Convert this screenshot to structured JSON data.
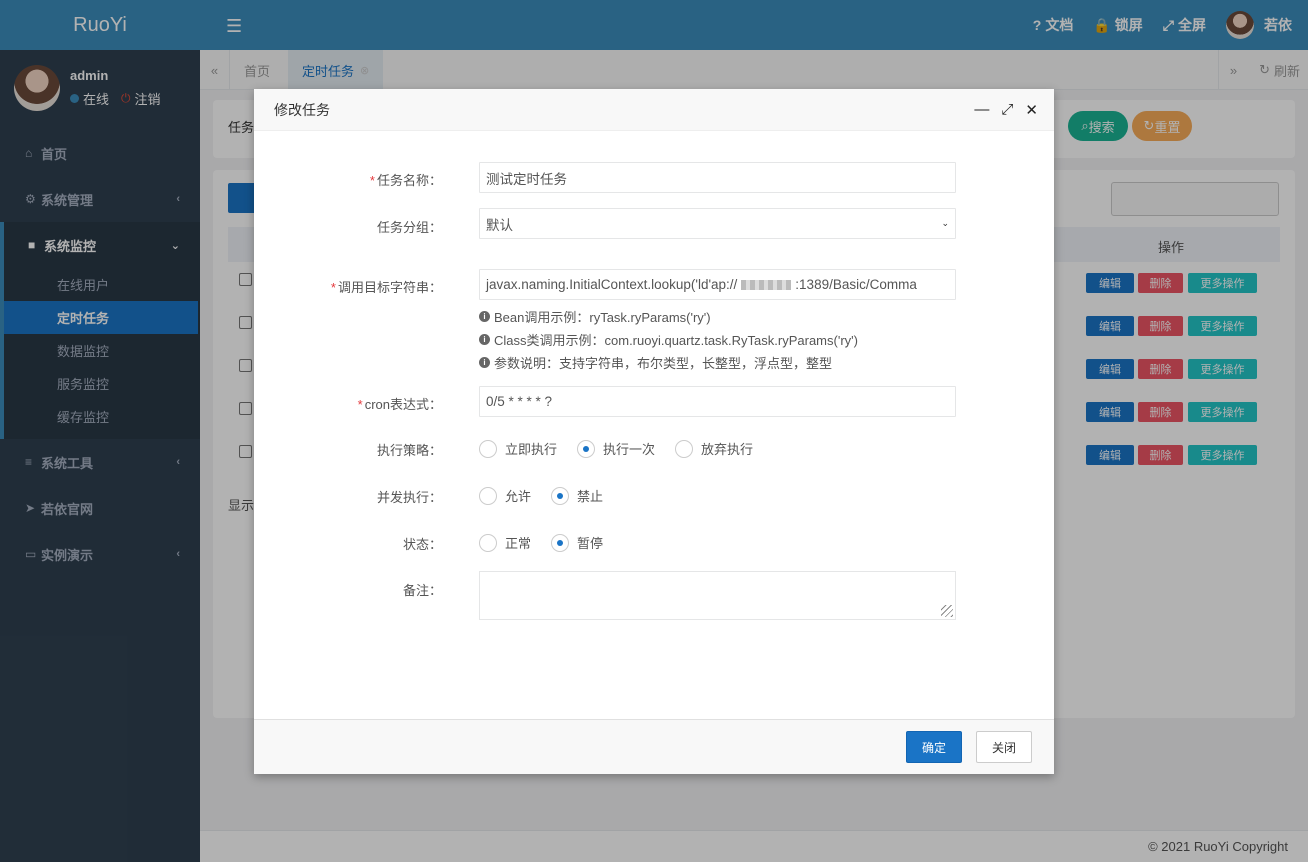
{
  "app": {
    "logo": "RuoYi"
  },
  "user": {
    "name": "admin",
    "status": "在线",
    "logout": "注销"
  },
  "sidebar": {
    "items": [
      {
        "label": "首页"
      },
      {
        "label": "系统管理"
      },
      {
        "label": "系统监控"
      },
      {
        "label": "系统工具"
      },
      {
        "label": "若依官网"
      },
      {
        "label": "实例演示"
      }
    ],
    "sub": [
      "在线用户",
      "定时任务",
      "数据监控",
      "服务监控",
      "缓存监控"
    ]
  },
  "header": {
    "docs": "文档",
    "lock": "锁屏",
    "fullscreen": "全屏",
    "username": "若依"
  },
  "tabs": {
    "home": "首页",
    "active": "定时任务",
    "refresh": "刷新"
  },
  "background": {
    "filter_label": "任务",
    "search": "搜索",
    "reset": "重置",
    "col_op": "操作",
    "show": "显示",
    "row_actions": {
      "edit": "编辑",
      "delete": "删除",
      "more": "更多操作"
    }
  },
  "footer": {
    "copyright": "© 2021 RuoYi Copyright"
  },
  "modal": {
    "title": "修改任务",
    "fields": {
      "job_name_label": "任务名称：",
      "job_name_value": "测试定时任务",
      "job_group_label": "任务分组：",
      "job_group_value": "默认",
      "invoke_label": "调用目标字符串：",
      "invoke_value_prefix": "javax.naming.InitialContext.lookup('ld'ap://",
      "invoke_value_suffix": ":1389/Basic/Comma",
      "help1": "Bean调用示例：ryTask.ryParams('ry')",
      "help2": "Class类调用示例：com.ruoyi.quartz.task.RyTask.ryParams('ry')",
      "help3": "参数说明：支持字符串，布尔类型，长整型，浮点型，整型",
      "cron_label": "cron表达式：",
      "cron_value": "0/5 * * * * ?",
      "policy_label": "执行策略：",
      "policy_options": [
        "立即执行",
        "执行一次",
        "放弃执行"
      ],
      "policy_selected": "执行一次",
      "concurrent_label": "并发执行：",
      "concurrent_options": [
        "允许",
        "禁止"
      ],
      "concurrent_selected": "禁止",
      "status_label": "状态：",
      "status_options": [
        "正常",
        "暂停"
      ],
      "status_selected": "暂停",
      "remark_label": "备注："
    },
    "buttons": {
      "ok": "确定",
      "close": "关闭"
    }
  },
  "colors": {
    "primary": "#1a74c6",
    "header": "#3c8dbc",
    "sidebar": "#2f4050",
    "danger": "#ed5565",
    "success": "#1ab394",
    "warning": "#f8ac59",
    "info": "#23c6c8"
  }
}
